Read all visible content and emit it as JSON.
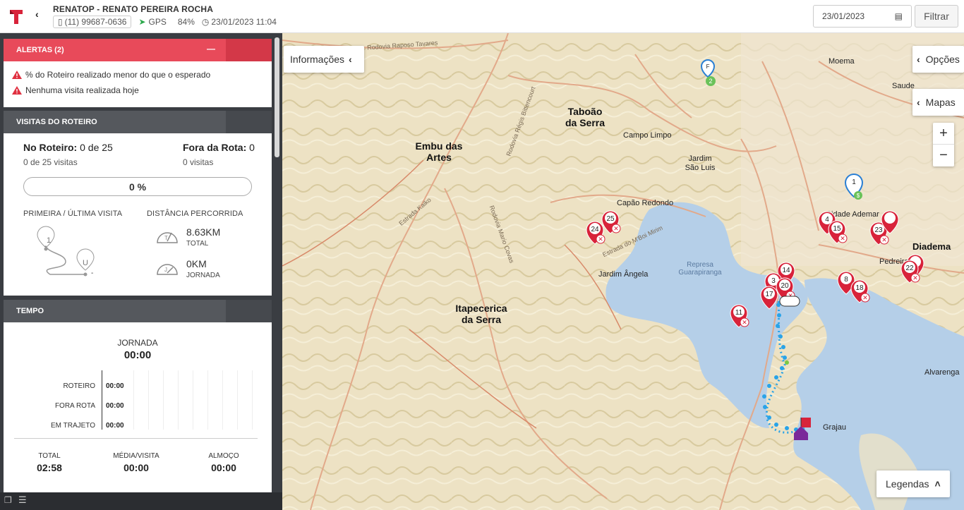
{
  "header": {
    "vehicle_name": "RENATOP - RENATO PEREIRA ROCHA",
    "phone": "(11) 99687-0636",
    "gps_label": "GPS",
    "battery": "84%",
    "timestamp": "23/01/2023 11:04",
    "date_value": "23/01/2023",
    "filter_label": "Filtrar"
  },
  "alerts": {
    "title": "ALERTAS (2)",
    "items": [
      "% do Roteiro realizado menor do que o esperado",
      "Nenhuma visita realizada hoje"
    ]
  },
  "visits": {
    "title": "VISITAS DO ROTEIRO",
    "on_route_label": "No Roteiro:",
    "on_route_value": "0 de 25",
    "on_route_sub": "0 de 25 visitas",
    "off_route_label": "Fora da Rota:",
    "off_route_value": "0",
    "off_route_sub": "0 visitas",
    "progress": "0 %",
    "first_last_label": "PRIMEIRA / ÚLTIMA VISITA",
    "distance_label": "DISTÂNCIA PERCORRIDA",
    "first_marker": "1",
    "last_marker": "U",
    "first_time": "-",
    "last_time": "-",
    "total_distance": "8.63KM",
    "total_label": "TOTAL",
    "journey_distance": "0KM",
    "journey_label": "JORNADA"
  },
  "time": {
    "title": "TEMPO",
    "journey_label": "JORNADA",
    "journey_value": "00:00",
    "rows": [
      {
        "label": "ROTEIRO",
        "value": "00:00"
      },
      {
        "label": "FORA ROTA",
        "value": "00:00"
      },
      {
        "label": "EM TRAJETO",
        "value": "00:00"
      }
    ],
    "total_label": "TOTAL",
    "total_value": "02:58",
    "avg_label": "MÉDIA/VISITA",
    "avg_value": "00:00",
    "lunch_label": "ALMOÇO",
    "lunch_value": "00:00"
  },
  "map": {
    "info_button": "Informações",
    "options_button": "Opções",
    "maps_button": "Mapas",
    "zoom_in": "+",
    "zoom_out": "−",
    "legend_button": "Legendas",
    "places": [
      "Taboão da Serra",
      "Embu das Artes",
      "Campo Limpo",
      "Jardim São Luis",
      "Capão Redondo",
      "Jardim Ângela",
      "Itapecerica da Serra",
      "Moema",
      "Saude",
      "Diadema",
      "Pedreira",
      "Grajau",
      "Alvarenga",
      "Cidade Ademar"
    ],
    "water": "Represa Guarapiranga",
    "roads": [
      "Rodovia Raposo Tavares",
      "Rodovia Régis Bittencourt",
      "Estrada Kaiko",
      "Rodovia Mario Covas",
      "Estrada do M'Boi Mirim"
    ],
    "markers": [
      "24",
      "25",
      "4",
      "15",
      "23",
      "14",
      "20",
      "3",
      "17",
      "11",
      "8",
      "18",
      "22",
      "1",
      "2",
      "F"
    ],
    "colors": {
      "primary": "#e84a5a",
      "marker": "#d8233a",
      "route": "#29a3e8",
      "water": "#b5cfe8"
    }
  }
}
